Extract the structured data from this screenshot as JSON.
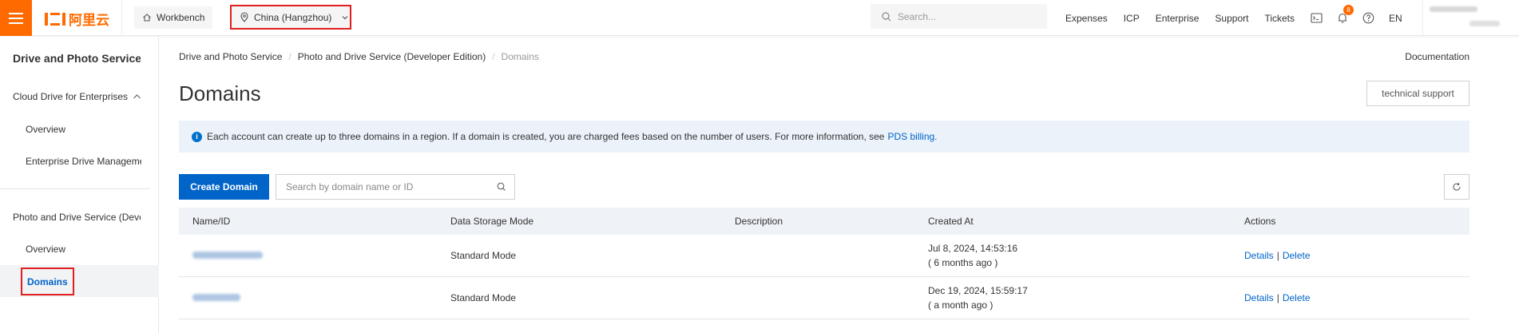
{
  "topbar": {
    "logo_text": "阿里云",
    "workbench_label": "Workbench",
    "region_label": "China (Hangzhou)",
    "search_placeholder": "Search...",
    "nav": [
      "Expenses",
      "ICP",
      "Enterprise",
      "Support",
      "Tickets"
    ],
    "notification_count": "8",
    "language": "EN",
    "brand_color": "#ff6a00"
  },
  "sidebar": {
    "title": "Drive and Photo Service I",
    "groups": [
      {
        "label": "Cloud Drive for Enterprises",
        "items": [
          "Overview",
          "Enterprise Drive Manageme"
        ]
      },
      {
        "label": "Photo and Drive Service (Deve",
        "items": [
          "Overview",
          "Domains"
        ]
      }
    ],
    "active_item": "Domains"
  },
  "main": {
    "breadcrumb": [
      "Drive and Photo Service",
      "Photo and Drive Service (Developer Edition)",
      "Domains"
    ],
    "documentation_label": "Documentation",
    "page_title": "Domains",
    "tech_support_label": "technical support",
    "notice_text": "Each account can create up to three domains in a region. If a domain is created, you are charged fees based on the number of users. For more information, see",
    "notice_link": "PDS billing.",
    "create_button": "Create Domain",
    "search_placeholder": "Search by domain name or ID",
    "table": {
      "headers": [
        "Name/ID",
        "Data Storage Mode",
        "Description",
        "Created At",
        "Actions"
      ],
      "rows": [
        {
          "mode": "Standard Mode",
          "description": "",
          "created": "Jul 8, 2024, 14:53:16",
          "created_rel": "( 6 months ago )",
          "details": "Details",
          "delete": "Delete"
        },
        {
          "mode": "Standard Mode",
          "description": "",
          "created": "Dec 19, 2024, 15:59:17",
          "created_rel": "( a month ago )",
          "details": "Details",
          "delete": "Delete"
        }
      ]
    },
    "accent_color": "#0064c8"
  }
}
